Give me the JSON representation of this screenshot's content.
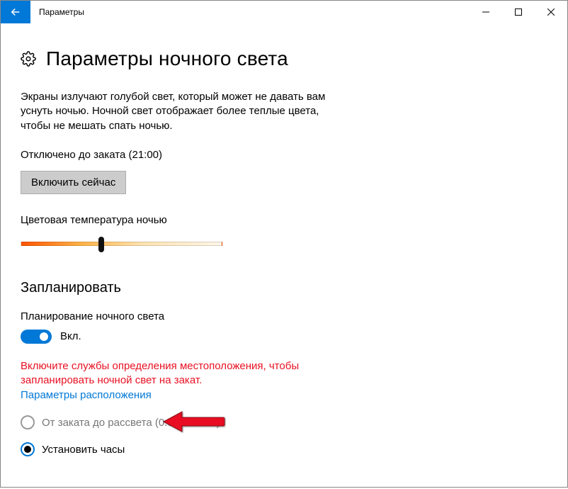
{
  "window": {
    "title": "Параметры"
  },
  "page": {
    "heading": "Параметры ночного света",
    "description": "Экраны излучают голубой свет, который может не давать вам уснуть ночью. Ночной свет отображает более теплые цвета, чтобы не мешать спать ночью.",
    "status": "Отключено до заката (21:00)",
    "turn_on_button": "Включить сейчас",
    "temperature_label": "Цветовая температура ночью",
    "slider_percent": 39
  },
  "schedule": {
    "heading": "Запланировать",
    "plan_label": "Планирование ночного света",
    "toggle_state_label": "Вкл.",
    "toggle_on": true,
    "warning": "Включите службы определения местоположения, чтобы запланировать ночной свет на закат.",
    "location_link": "Параметры расположения",
    "radio_sunset_label": "От заката до рассвета (0:00 — 0:00)",
    "radio_hours_label": "Установить часы",
    "selected_radio": "hours"
  },
  "colors": {
    "accent": "#0078d7",
    "warn": "#e81123"
  }
}
